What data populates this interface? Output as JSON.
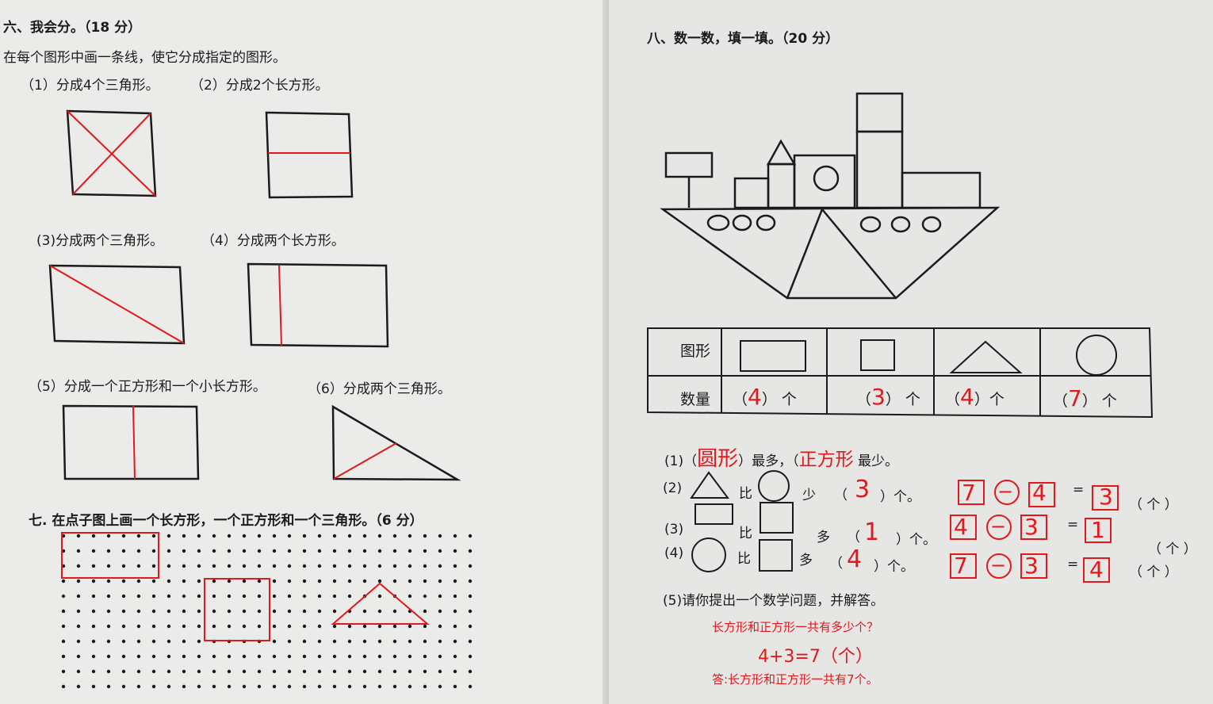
{
  "section6": {
    "heading": "六、我会分。（18 分）",
    "instruction": "在每个图形中画一条线，使它分成指定的图形。",
    "q1": "（1）分成4个三角形。",
    "q2": "（2）分成2个长方形。",
    "q3": "(3)分成两个三角形。",
    "q4": "（4）分成两个长方形。",
    "q5": "（5）分成一个正方形和一个小长方形。",
    "q6": "（6）分成两个三角形。"
  },
  "section7": {
    "heading": "七. 在点子图上画一个长方形，一个正方形和一个三角形。（6 分）"
  },
  "section8": {
    "heading": "八、数一数，填一填。（20 分）",
    "table": {
      "row1_label": "图形",
      "row2_label": "数量",
      "shapes": [
        "rectangle-icon",
        "square-icon",
        "triangle-icon",
        "circle-icon"
      ],
      "open": "（",
      "close": "）",
      "unit": "个",
      "counts": [
        "4",
        "3",
        "4",
        "7"
      ]
    },
    "q1": {
      "prefix": "(1)（",
      "answer_most": "圆形",
      "mid": "）最多，（",
      "answer_least": "正方形",
      "suffix": "最少。"
    },
    "q2": {
      "label": "(2)",
      "compare": "比",
      "word": "少",
      "open": "（",
      "answer": "3",
      "close": "）个。",
      "eq": [
        "7",
        "4",
        "3"
      ],
      "unit": "（ 个 ）"
    },
    "q3": {
      "label": "(3)",
      "compare": "比",
      "word": "多",
      "open": "（",
      "answer": "1",
      "close": "）个。",
      "eq": [
        "4",
        "3",
        "1"
      ],
      "unit": "（ 个 ）"
    },
    "q4": {
      "label": "(4)",
      "compare": "比",
      "word": "多",
      "open": "（",
      "answer": "4",
      "close": "）个。",
      "eq": [
        "7",
        "3",
        "4"
      ],
      "unit": "（ 个 ）"
    },
    "minus_sign": "−",
    "equals_sign": "=",
    "q5": {
      "prompt": "(5)请你提出一个数学问题，并解答。",
      "question": "长方形和正方形一共有多少个？",
      "equation": "4+3=7（个）",
      "answer": "答:长方形和正方形一共有7个。"
    }
  },
  "colors": {
    "ink": "#1b1b1b",
    "answer_red": "#e3181c",
    "paper": "#ebebe9"
  }
}
